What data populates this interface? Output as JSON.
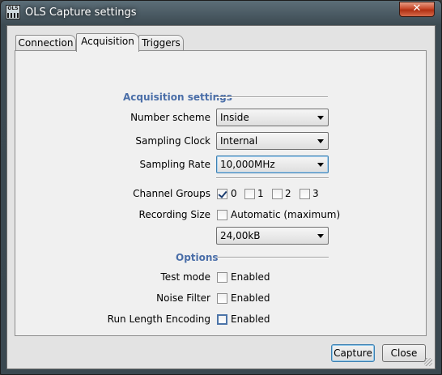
{
  "window": {
    "title": "OLS Capture settings",
    "icon_name": "ols-app-icon",
    "icon_text": "OLS",
    "close_label": "✕"
  },
  "tabs": [
    {
      "label": "Connection",
      "selected": false
    },
    {
      "label": "Acquisition",
      "selected": true
    },
    {
      "label": "Triggers",
      "selected": false
    }
  ],
  "acquisition": {
    "heading": "Acquisition settings",
    "number_scheme": {
      "label": "Number scheme",
      "value": "Inside"
    },
    "sampling_clock": {
      "label": "Sampling Clock",
      "value": "Internal"
    },
    "sampling_rate": {
      "label": "Sampling Rate",
      "value": "10,000MHz"
    },
    "channel_groups": {
      "label": "Channel Groups",
      "items": [
        {
          "label": "0",
          "checked": true
        },
        {
          "label": "1",
          "checked": false
        },
        {
          "label": "2",
          "checked": false
        },
        {
          "label": "3",
          "checked": false
        }
      ]
    },
    "recording_size": {
      "label": "Recording Size",
      "automatic_label": "Automatic (maximum)",
      "automatic_checked": false,
      "value": "24,00kB"
    }
  },
  "options": {
    "heading": "Options",
    "test_mode": {
      "label": "Test mode",
      "check_label": "Enabled",
      "checked": false
    },
    "noise_filter": {
      "label": "Noise Filter",
      "check_label": "Enabled",
      "checked": false
    },
    "rle": {
      "label": "Run Length Encoding",
      "check_label": "Enabled",
      "checked": false
    }
  },
  "buttons": {
    "capture": "Capture",
    "close": "Close"
  },
  "colors": {
    "section_heading": "#4a6ea8",
    "close_button": "#c8492a",
    "focus_border": "#3c7fb1"
  }
}
